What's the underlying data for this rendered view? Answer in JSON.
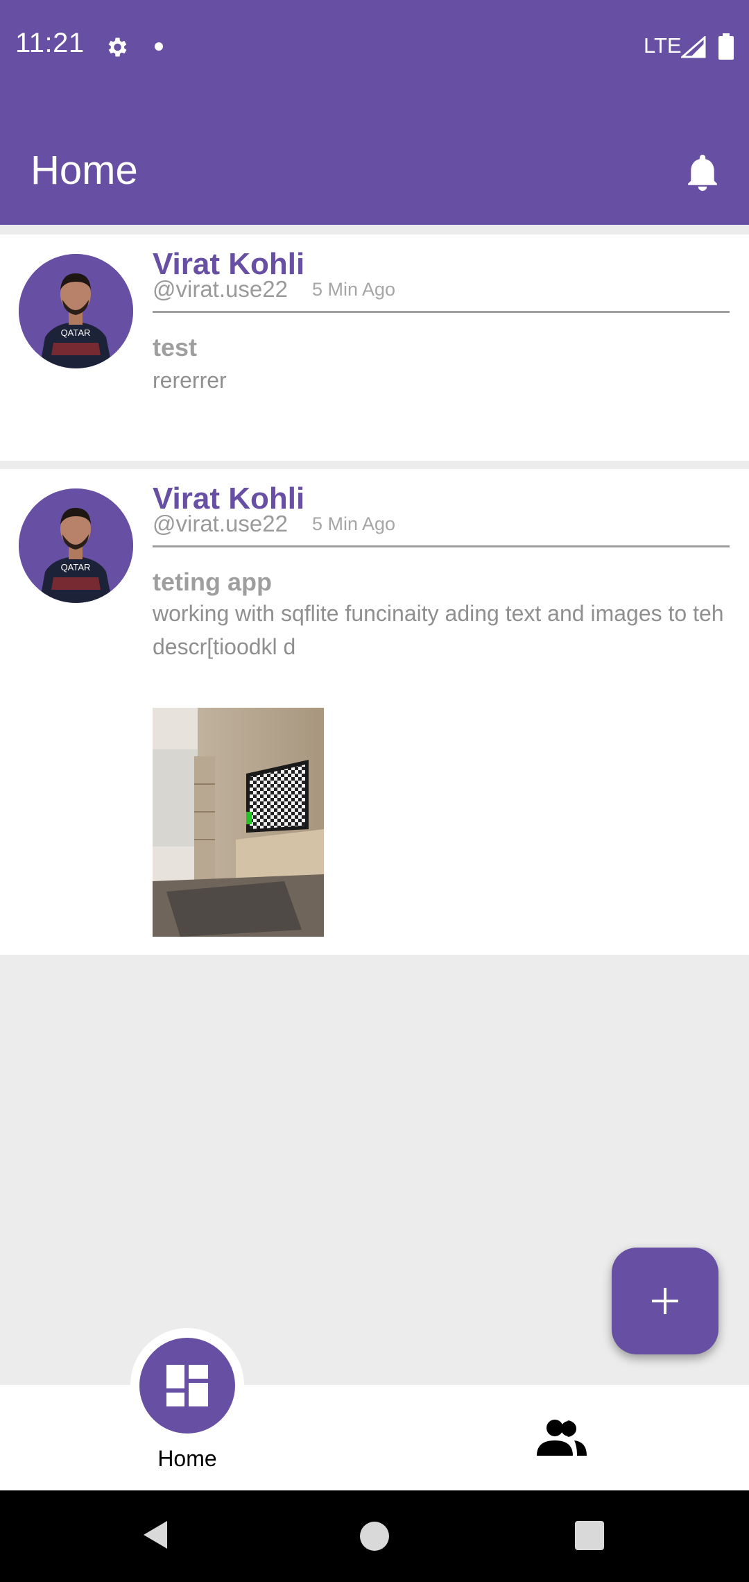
{
  "status_bar": {
    "time": "11:21",
    "network": "LTE"
  },
  "app_bar": {
    "title": "Home"
  },
  "posts": [
    {
      "author": "Virat Kohli",
      "handle": "@virat.use22",
      "time_ago": "5 Min Ago",
      "title": "test",
      "description": "rererrer",
      "avatar_jersey_text": "QATAR"
    },
    {
      "author": "Virat Kohli",
      "handle": "@virat.use22",
      "time_ago": "5 Min Ago",
      "title": "teting app",
      "description": "working with sqflite funcinaity ading text and images to teh descr[tioodkl d",
      "avatar_jersey_text": "QATAR"
    }
  ],
  "bottom_nav": {
    "home_label": "Home"
  },
  "colors": {
    "primary": "#674fa3",
    "background": "#ececec"
  }
}
